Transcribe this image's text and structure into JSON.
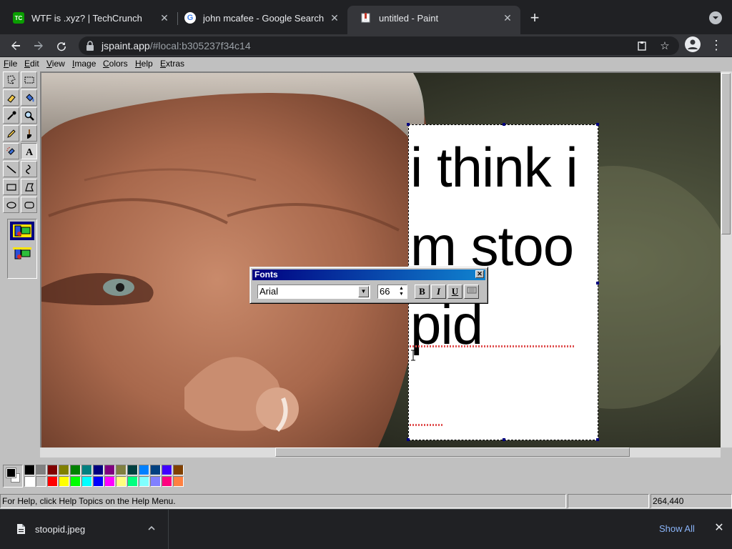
{
  "browser": {
    "tabs": [
      {
        "title": "WTF is .xyz? | TechCrunch",
        "icon": "techcrunch-icon",
        "favicon_text": "TC",
        "active": false
      },
      {
        "title": "john mcafee - Google Search",
        "icon": "google-icon",
        "active": false
      },
      {
        "title": "untitled - Paint",
        "icon": "paint-icon",
        "active": true
      }
    ],
    "url_host": "jspaint.app",
    "url_rest": "/#local:b305237f34c14"
  },
  "paint": {
    "menu": [
      "File",
      "Edit",
      "View",
      "Image",
      "Colors",
      "Help",
      "Extras"
    ],
    "tools": [
      "free-form-select",
      "select",
      "eraser",
      "fill-with-color",
      "pick-color",
      "magnifier",
      "pencil",
      "brush",
      "airbrush",
      "text",
      "line",
      "curve",
      "rectangle",
      "polygon",
      "ellipse",
      "rounded-rectangle"
    ],
    "selected_tool": "text",
    "textbox_text": "i think im stoopid",
    "fonts_dialog": {
      "title": "Fonts",
      "font_family": "Arial",
      "font_size": "66",
      "bold_label": "B",
      "italic_label": "I",
      "underline_label": "U"
    },
    "palette": {
      "foreground": "#000000",
      "background": "#ffffff",
      "top_row": [
        "#000000",
        "#808080",
        "#800000",
        "#808000",
        "#008000",
        "#008080",
        "#000080",
        "#800080",
        "#808040",
        "#004040",
        "#0080ff",
        "#004080",
        "#4000ff",
        "#804000"
      ],
      "bottom_row": [
        "#ffffff",
        "#c0c0c0",
        "#ff0000",
        "#ffff00",
        "#00ff00",
        "#00ffff",
        "#0000ff",
        "#ff00ff",
        "#ffff80",
        "#00ff80",
        "#80ffff",
        "#8080ff",
        "#ff0080",
        "#ff8040"
      ]
    },
    "status": {
      "help_text": "For Help, click Help Topics on the Help Menu.",
      "size_cell": "",
      "coordinates": "264,440"
    }
  },
  "downloads": {
    "file_name": "stoopid.jpeg",
    "show_all_label": "Show All"
  }
}
